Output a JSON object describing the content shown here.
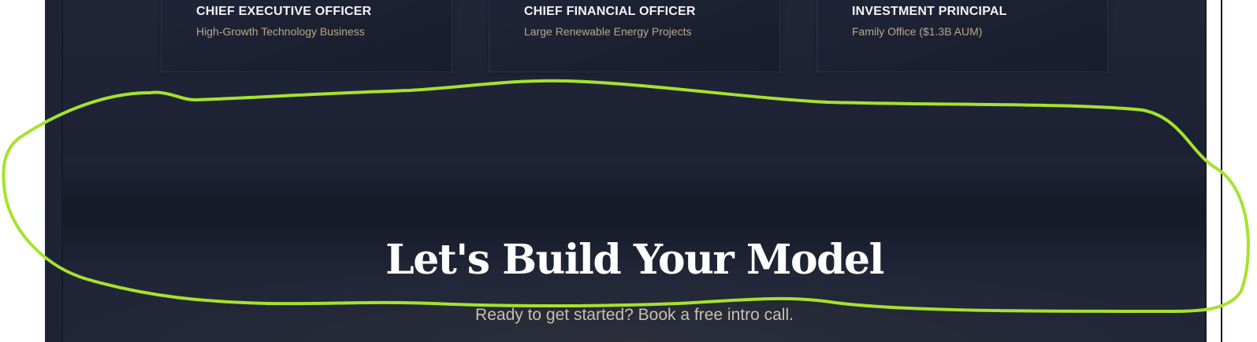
{
  "cards": [
    {
      "role": "CHIEF EXECUTIVE OFFICER",
      "desc": "High-Growth Technology Business"
    },
    {
      "role": "CHIEF FINANCIAL OFFICER",
      "desc": "Large Renewable Energy Projects"
    },
    {
      "role": "INVESTMENT PRINCIPAL",
      "desc": "Family Office ($1.3B AUM)"
    }
  ],
  "cta": {
    "title": "Let's Build Your Model",
    "subtitle": "Ready to get started? Book a free intro call."
  },
  "colors": {
    "background": "#1e2436",
    "card_title": "#f2f3f6",
    "card_desc": "#b9a98a",
    "subtitle": "#c9bfae",
    "annotation_stroke": "#a6e22e"
  }
}
